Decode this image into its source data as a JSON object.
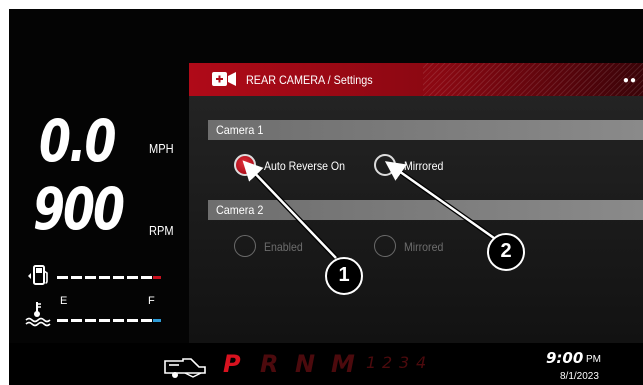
{
  "gauges": {
    "speed": "0.0",
    "speed_unit": "MPH",
    "rpm": "900",
    "rpm_unit": "RPM",
    "temp_empty_label": "E",
    "temp_full_label": "F",
    "fuel_level": 0.8,
    "temp_level": 0.85
  },
  "panel": {
    "title": "REAR CAMERA / Settings",
    "camera1": {
      "label": "Camera 1",
      "options": [
        {
          "label": "Auto Reverse On",
          "selected": true
        },
        {
          "label": "Mirrored",
          "selected": false
        }
      ]
    },
    "camera2": {
      "label": "Camera 2",
      "options": [
        {
          "label": "Enabled",
          "enabled": false
        },
        {
          "label": "Mirrored",
          "enabled": false
        }
      ]
    }
  },
  "bottom_bar": {
    "gears": [
      "P",
      "R",
      "N",
      "M"
    ],
    "gear_numbers": [
      "1",
      "2",
      "3",
      "4"
    ],
    "active_gear": "P",
    "time": "9:00",
    "ampm": "PM",
    "date": "8/1/2023"
  },
  "callouts": [
    "1",
    "2"
  ],
  "colors": {
    "accent_red": "#c8101e",
    "fuel_warning_red": "#c8101e",
    "temp_blue": "#2e9bd6"
  }
}
